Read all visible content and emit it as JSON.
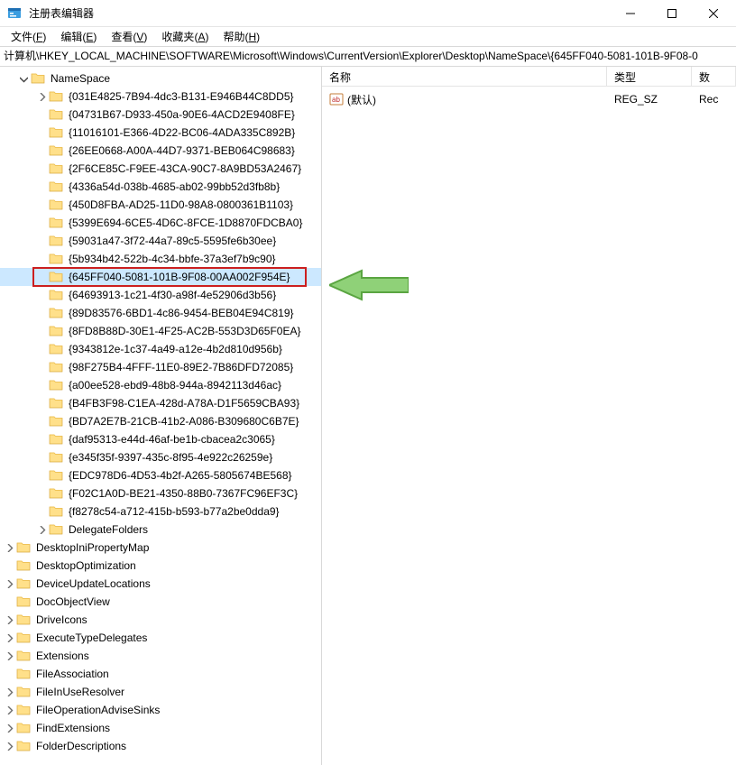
{
  "window": {
    "title": "注册表编辑器"
  },
  "menu": {
    "file": {
      "label": "文件",
      "accel": "F"
    },
    "edit": {
      "label": "编辑",
      "accel": "E"
    },
    "view": {
      "label": "查看",
      "accel": "V"
    },
    "fav": {
      "label": "收藏夹",
      "accel": "A"
    },
    "help": {
      "label": "帮助",
      "accel": "H"
    }
  },
  "address": "计算机\\HKEY_LOCAL_MACHINE\\SOFTWARE\\Microsoft\\Windows\\CurrentVersion\\Explorer\\Desktop\\NameSpace\\{645FF040-5081-101B-9F08-0",
  "tree": {
    "root": {
      "label": "NameSpace",
      "expanded": true
    },
    "children": [
      {
        "label": "{031E4825-7B94-4dc3-B131-E946B44C8DD5}",
        "hasChildren": true
      },
      {
        "label": "{04731B67-D933-450a-90E6-4ACD2E9408FE}"
      },
      {
        "label": "{11016101-E366-4D22-BC06-4ADA335C892B}"
      },
      {
        "label": "{26EE0668-A00A-44D7-9371-BEB064C98683}"
      },
      {
        "label": "{2F6CE85C-F9EE-43CA-90C7-8A9BD53A2467}"
      },
      {
        "label": "{4336a54d-038b-4685-ab02-99bb52d3fb8b}"
      },
      {
        "label": "{450D8FBA-AD25-11D0-98A8-0800361B1103}"
      },
      {
        "label": "{5399E694-6CE5-4D6C-8FCE-1D8870FDCBA0}"
      },
      {
        "label": "{59031a47-3f72-44a7-89c5-5595fe6b30ee}"
      },
      {
        "label": "{5b934b42-522b-4c34-bbfe-37a3ef7b9c90}"
      },
      {
        "label": "{645FF040-5081-101B-9F08-00AA002F954E}",
        "selected": true,
        "highlighted": true
      },
      {
        "label": "{64693913-1c21-4f30-a98f-4e52906d3b56}"
      },
      {
        "label": "{89D83576-6BD1-4c86-9454-BEB04E94C819}"
      },
      {
        "label": "{8FD8B88D-30E1-4F25-AC2B-553D3D65F0EA}"
      },
      {
        "label": "{9343812e-1c37-4a49-a12e-4b2d810d956b}"
      },
      {
        "label": "{98F275B4-4FFF-11E0-89E2-7B86DFD72085}"
      },
      {
        "label": "{a00ee528-ebd9-48b8-944a-8942113d46ac}"
      },
      {
        "label": "{B4FB3F98-C1EA-428d-A78A-D1F5659CBA93}"
      },
      {
        "label": "{BD7A2E7B-21CB-41b2-A086-B309680C6B7E}"
      },
      {
        "label": "{daf95313-e44d-46af-be1b-cbacea2c3065}"
      },
      {
        "label": "{e345f35f-9397-435c-8f95-4e922c26259e}"
      },
      {
        "label": "{EDC978D6-4D53-4b2f-A265-5805674BE568}"
      },
      {
        "label": "{F02C1A0D-BE21-4350-88B0-7367FC96EF3C}"
      },
      {
        "label": "{f8278c54-a712-415b-b593-b77a2be0dda9}"
      },
      {
        "label": "DelegateFolders",
        "hasChildren": true
      }
    ],
    "siblings": [
      {
        "label": "DesktopIniPropertyMap",
        "hasChildren": true
      },
      {
        "label": "DesktopOptimization"
      },
      {
        "label": "DeviceUpdateLocations",
        "hasChildren": true
      },
      {
        "label": "DocObjectView"
      },
      {
        "label": "DriveIcons",
        "hasChildren": true
      },
      {
        "label": "ExecuteTypeDelegates",
        "hasChildren": true
      },
      {
        "label": "Extensions",
        "hasChildren": true
      },
      {
        "label": "FileAssociation"
      },
      {
        "label": "FileInUseResolver",
        "hasChildren": true
      },
      {
        "label": "FileOperationAdviseSinks",
        "hasChildren": true
      },
      {
        "label": "FindExtensions",
        "hasChildren": true
      },
      {
        "label": "FolderDescriptions",
        "hasChildren": true
      }
    ]
  },
  "right": {
    "columns": {
      "name": "名称",
      "type": "类型",
      "data": "数"
    },
    "rows": [
      {
        "name": "(默认)",
        "type": "REG_SZ",
        "data": "Rec"
      }
    ]
  }
}
